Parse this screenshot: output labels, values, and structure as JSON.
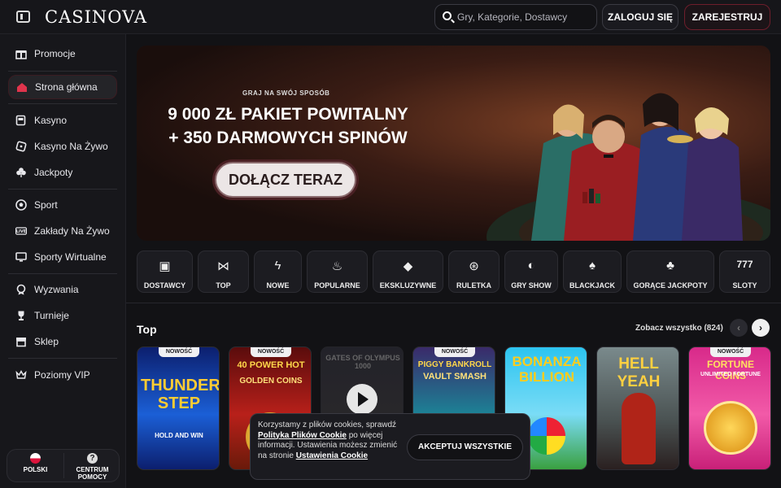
{
  "header": {
    "logo": "CASINOVA",
    "search_placeholder": "Gry, Kategorie, Dostawcy",
    "login_label": "ZALOGUJ SIĘ",
    "register_label": "ZAREJESTRUJ"
  },
  "sidebar": {
    "items": [
      {
        "label": "Promocje",
        "icon": "gift-icon"
      },
      {
        "label": "Strona główna",
        "icon": "home-icon",
        "active": true
      },
      {
        "label": "Kasyno",
        "icon": "slot-machine-icon"
      },
      {
        "label": "Kasyno Na Żywo",
        "icon": "live-dice-icon"
      },
      {
        "label": "Jackpoty",
        "icon": "clover-icon"
      },
      {
        "label": "Sport",
        "icon": "football-icon"
      },
      {
        "label": "Zakłady Na Żywo",
        "icon": "live-badge-icon"
      },
      {
        "label": "Sporty Wirtualne",
        "icon": "monitor-icon"
      },
      {
        "label": "Wyzwania",
        "icon": "medal-icon"
      },
      {
        "label": "Turnieje",
        "icon": "trophy-icon"
      },
      {
        "label": "Sklep",
        "icon": "shop-icon"
      },
      {
        "label": "Poziomy VIP",
        "icon": "crown-icon"
      }
    ],
    "language_label": "POLSKI",
    "help_label_1": "CENTRUM",
    "help_label_2": "POMOCY"
  },
  "hero": {
    "tagline": "GRAJ NA SWÓJ SPOSÓB",
    "title_line1": "9 000 ZŁ PAKIET POWITALNY",
    "title_line2": "+ 350 DARMOWYCH SPINÓW",
    "cta_label": "DOŁĄCZ TERAZ"
  },
  "categories": [
    {
      "label": "DOSTAWCY",
      "icon": "provider-icon"
    },
    {
      "label": "TOP",
      "icon": "bowtie-icon"
    },
    {
      "label": "NOWE",
      "icon": "lightning-icon"
    },
    {
      "label": "POPULARNE",
      "icon": "flame-icon"
    },
    {
      "label": "EKSKLUZYWNE",
      "icon": "diamond-icon"
    },
    {
      "label": "RULETKA",
      "icon": "roulette-icon"
    },
    {
      "label": "GRY SHOW",
      "icon": "mask-icon"
    },
    {
      "label": "BLACKJACK",
      "icon": "cards-icon"
    },
    {
      "label": "GORĄCE JACKPOTY",
      "icon": "hot-bag-icon"
    },
    {
      "label": "SLOTY",
      "icon": "sevens-icon"
    }
  ],
  "section": {
    "title": "Top",
    "see_all_label": "Zobacz wszystko (824)"
  },
  "games": [
    {
      "title": "THUNDER STEP",
      "subtitle": "HOLD AND WIN",
      "badge": "NOWOŚĆ"
    },
    {
      "title": "40 POWER HOT",
      "subtitle": "GOLDEN COINS",
      "badge": "NOWOŚĆ"
    },
    {
      "title": "GATES OF OLYMPUS 1000",
      "subtitle": "",
      "badge": ""
    },
    {
      "title": "PIGGY BANKROLL",
      "subtitle": "VAULT SMASH",
      "badge": "NOWOŚĆ"
    },
    {
      "title": "BONANZA BILLION",
      "subtitle": "",
      "badge": ""
    },
    {
      "title": "HELL YEAH",
      "subtitle": "",
      "badge": ""
    },
    {
      "title": "FORTUNE COINS",
      "subtitle": "UNLIMITED FORTUNE",
      "badge": "NOWOŚĆ"
    }
  ],
  "cookie": {
    "text_1": "Korzystamy z plików cookies, sprawdź",
    "policy_link": "Polityka Plików Cookie",
    "text_2": "po więcej informacji. Ustawienia możesz zmienić na stronie",
    "settings_link": "Ustawienia Cookie",
    "accept_label": "AKCEPTUJ WSZYSTKIE"
  },
  "colors": {
    "accent": "#e0344c",
    "background": "#121215",
    "panel": "#17171b"
  }
}
